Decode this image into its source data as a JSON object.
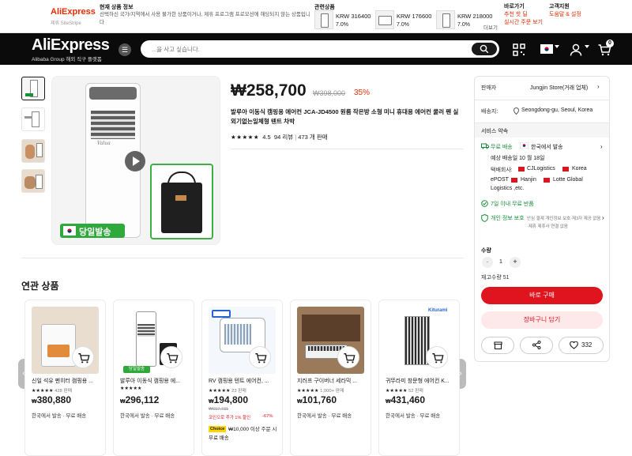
{
  "topbar": {
    "logo": "AliExpress",
    "logo_sub": "제휴 SiteStripe",
    "notice_title": "현재 상품 정보",
    "notice_text": "선택하신 국가/지역에서 사용 불가한 상품이거나, 제휴 프로그램 프로모션에 해당되지 않는 상품입니다",
    "related_title": "관련상품",
    "related": [
      {
        "price": "KRW 316400",
        "pct": "7.0%"
      },
      {
        "price": "KRW 176600",
        "pct": "7.0%"
      },
      {
        "price": "KRW 218000",
        "pct": "7.0%"
      }
    ],
    "more": "더보기",
    "col1_title": "바로가기",
    "col1_link": "추천 핫 딜",
    "col1_link2": "실시간 주문 보기",
    "col2_title": "고객지원",
    "col2_link": "도움말 & 설정"
  },
  "header": {
    "logo": "AliExpress",
    "logo_sub": "Alibaba Group  해외 직구 플랫폼",
    "search_placeholder": "...을 사고 싶습니다.",
    "cart_count": "0"
  },
  "product": {
    "price": "₩258,700",
    "original_price": "₩398,000",
    "discount": "35%",
    "title": "발루아 이동식 캠핑용 에어컨 JCA-JD4500 원룸 작은방 소형 미니 휴대용 에어컨 쿨러 펜 실외기없는일체형 텐트 차박",
    "stars": "★★★★★",
    "rating": "4.5",
    "reviews": "94 리뷰",
    "sold": "473 개 판매",
    "badge": "당일발송"
  },
  "panel": {
    "seller_label": "판매자",
    "seller_name": "Jungjin Store(거래 업체)",
    "ship_to_label": "배송지:",
    "ship_to": "Seongdong-gu, Seoul, Korea",
    "service_title": "서비스 약속",
    "free_ship": "무료 배송",
    "ship_from": "한국에서 발송",
    "eta": "예상 배송일 10 월 18일",
    "couriers_label": "택배회사:",
    "couriers_1": "CJLogistics",
    "couriers_1b": "Korea",
    "couriers_2": "ePOST",
    "couriers_2b": "Hanjin",
    "couriers_2c": "Lotte Global",
    "couriers_3": "Logistics ,etc.",
    "returns": "7일 이내 무료 반품",
    "privacy_title": "개인 정보 보호",
    "privacy_text": "안심 결제 개인정보 보호·제3자 제공 없음·제휴 제휴사 연결 없음",
    "qty_label": "수량",
    "qty": "1",
    "stock": "재고수량 51",
    "buy": "바로 구매",
    "add_cart": "장바구니 담기",
    "wish_count": "332"
  },
  "related": {
    "title": "연관 상품",
    "items": [
      {
        "name": "신일 석유 펜히터 캠핑용 ...",
        "stars": "★★★★★",
        "meta": "428 판매",
        "price": "380,880",
        "ship": "한국에서 발송 · 무료 배송"
      },
      {
        "name": "발루아 이동식 캠핑용 에...",
        "stars": "★★★★★",
        "meta": "",
        "price": "296,112",
        "ship": "한국에서 발송 · 무료 배송",
        "tag": "당일발송"
      },
      {
        "name": "RV 캠핑용 텐트 에어컨, ...",
        "stars": "★★★★★",
        "meta": "23 판매",
        "price": "194,800",
        "orig": "₩607,731",
        "coupon": "코인으로 추가 1% 할인",
        "coupon_pct": "-67%",
        "choice": "Choice",
        "choice_text": "₩10,000 이상 주문 시 무료 배송"
      },
      {
        "name": "지러프 구이버너 세라믹 ...",
        "stars": "★★★★★",
        "meta": "1,000+ 판매",
        "price": "101,760",
        "ship": "한국에서 발송 · 무료 배송"
      },
      {
        "name": "귀뚜라미 창문형 에어컨 K...",
        "stars": "★★★★★",
        "meta": "52 판매",
        "price": "431,460",
        "ship": "한국에서 발송 · 무료 배송"
      }
    ]
  },
  "colors": {
    "accent": "#e62e04",
    "buy": "#e0141e",
    "header": "#0b0b0b"
  }
}
